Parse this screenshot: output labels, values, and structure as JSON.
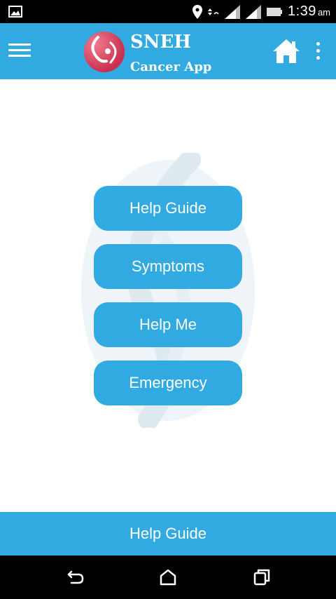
{
  "status_bar": {
    "time": "1:39",
    "ampm": "am",
    "icons": [
      "gallery-icon",
      "location-icon",
      "data-arrows-icon",
      "signal-icon",
      "signal-icon",
      "battery-icon"
    ]
  },
  "app_bar": {
    "title": "SNEH",
    "subtitle": "Cancer App",
    "icons": [
      "menu-icon",
      "logo-icon",
      "home-icon",
      "more-vert-icon"
    ],
    "color": "#31a9e1"
  },
  "menu": {
    "items": [
      {
        "label": "Help Guide"
      },
      {
        "label": "Symptoms"
      },
      {
        "label": "Help Me"
      },
      {
        "label": "Emergency"
      }
    ]
  },
  "bottom_bar": {
    "label": "Help Guide"
  },
  "nav_bar": {
    "icons": [
      "back-icon",
      "home-nav-icon",
      "recents-icon"
    ]
  }
}
